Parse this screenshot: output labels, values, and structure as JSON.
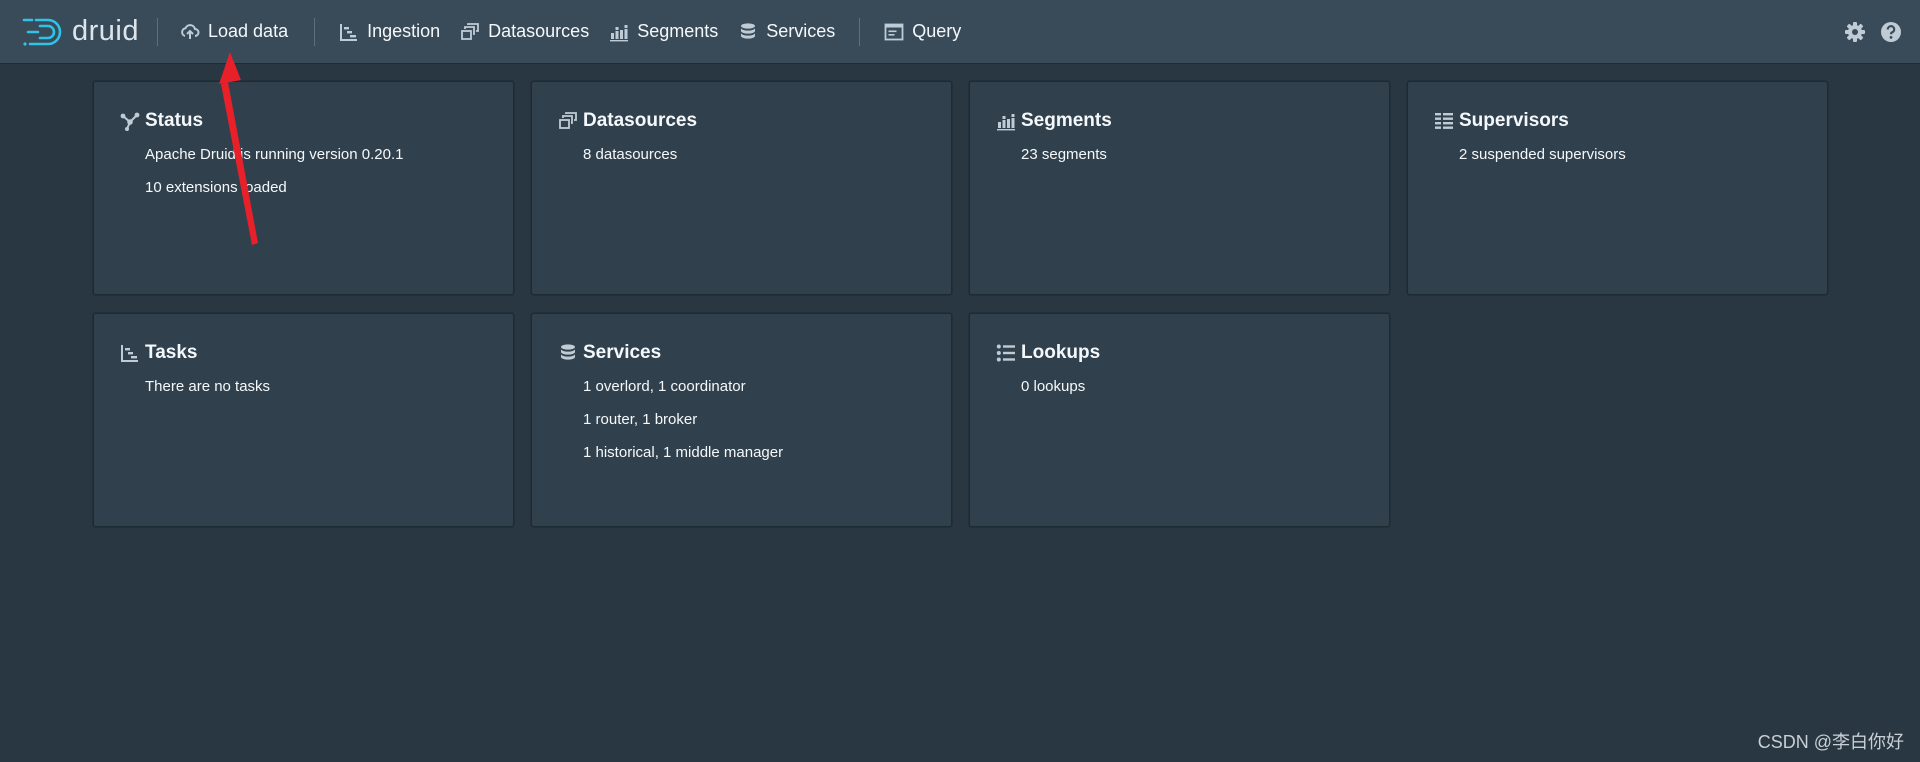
{
  "header": {
    "logo_text": "druid",
    "nav": [
      {
        "label": "Load data",
        "icon": "cloud-upload-icon"
      },
      {
        "label": "Ingestion",
        "icon": "gantt-chart-icon"
      },
      {
        "label": "Datasources",
        "icon": "multi-select-icon"
      },
      {
        "label": "Segments",
        "icon": "stacked-chart-icon"
      },
      {
        "label": "Services",
        "icon": "database-icon"
      },
      {
        "label": "Query",
        "icon": "application-icon"
      }
    ],
    "right_icons": [
      "gear-icon",
      "help-icon"
    ]
  },
  "cards": [
    {
      "title": "Status",
      "icon": "graph-icon",
      "lines": [
        "Apache Druid is running version 0.20.1",
        "10 extensions loaded"
      ]
    },
    {
      "title": "Datasources",
      "icon": "multi-select-icon",
      "lines": [
        "8 datasources"
      ]
    },
    {
      "title": "Segments",
      "icon": "stacked-chart-icon",
      "lines": [
        "23 segments"
      ]
    },
    {
      "title": "Supervisors",
      "icon": "list-columns-icon",
      "lines": [
        "2 suspended supervisors"
      ]
    },
    {
      "title": "Tasks",
      "icon": "gantt-chart-icon",
      "lines": [
        "There are no tasks"
      ]
    },
    {
      "title": "Services",
      "icon": "database-icon",
      "lines": [
        "1 overlord, 1 coordinator",
        "1 router, 1 broker",
        "1 historical, 1 middle manager"
      ]
    },
    {
      "title": "Lookups",
      "icon": "properties-icon",
      "lines": [
        "0 lookups"
      ]
    }
  ],
  "watermark": "CSDN @李白你好",
  "colors": {
    "page_bg": "#293742",
    "topbar_bg": "#394b59",
    "card_bg": "#30404d",
    "annotation_arrow": "#e8202a",
    "logo_accent": "#2fc3e8"
  }
}
